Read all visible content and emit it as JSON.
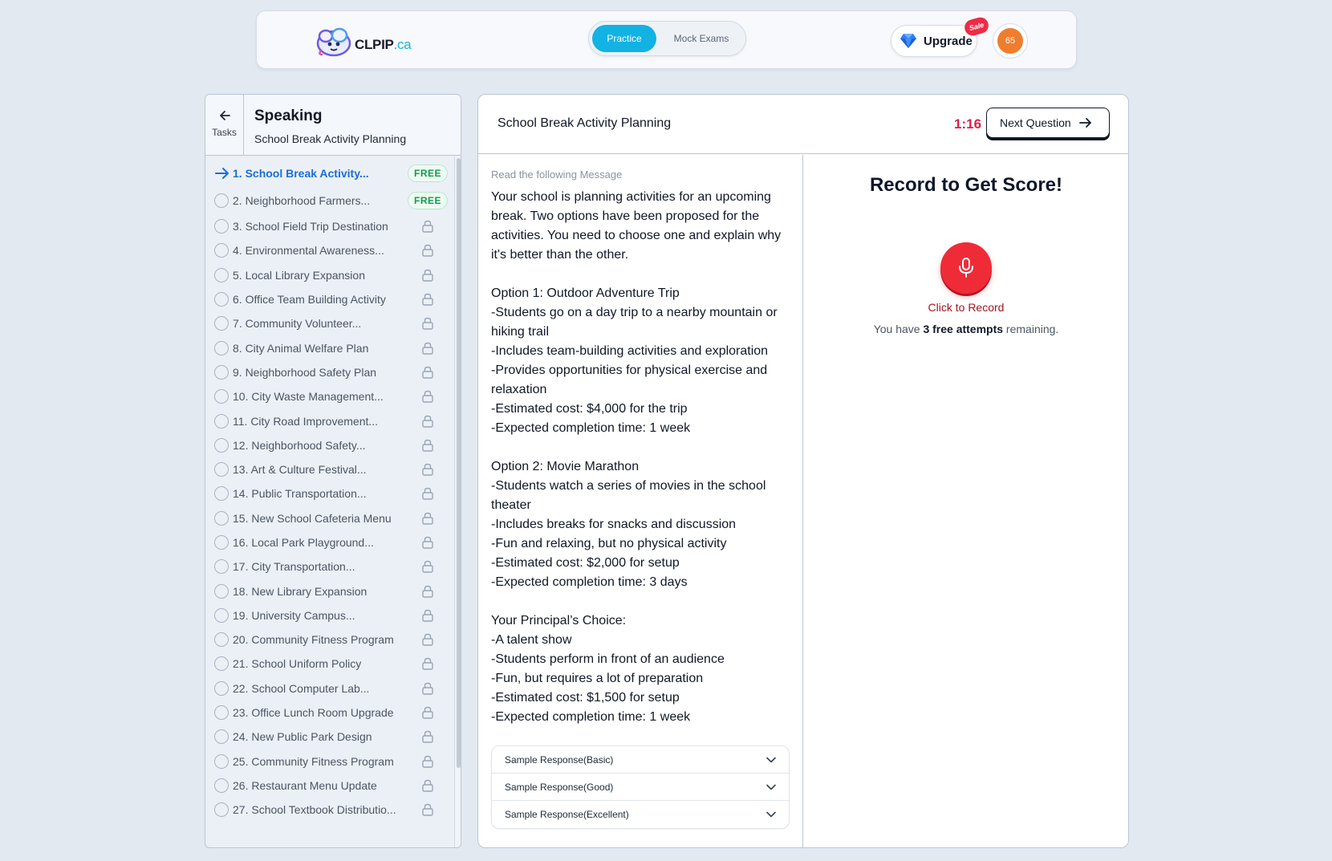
{
  "topbar": {
    "logo_text_main": "CLPIP",
    "logo_text_suffix": ".ca",
    "mode_tabs": [
      "Practice",
      "Mock Exams"
    ],
    "active_tab": "Practice",
    "upgrade_label": "Upgrade",
    "sale_badge": "Sale",
    "avatar_text": "65",
    "colors": {
      "accent": "#12b2e3",
      "sale": "#ef2b46",
      "avatar": "#f07d2e"
    }
  },
  "sidebar": {
    "back_label": "Tasks",
    "title": "Speaking",
    "subtitle": "School Break Activity Planning",
    "free_label": "FREE",
    "items": [
      {
        "label": "1. School Break Activity...",
        "status": "current",
        "badge": "free"
      },
      {
        "label": "2. Neighborhood Farmers...",
        "status": "open",
        "badge": "free"
      },
      {
        "label": "3. School Field Trip Destination",
        "status": "locked"
      },
      {
        "label": "4. Environmental Awareness...",
        "status": "locked"
      },
      {
        "label": "5. Local Library Expansion",
        "status": "locked"
      },
      {
        "label": "6. Office Team Building Activity",
        "status": "locked"
      },
      {
        "label": "7. Community Volunteer...",
        "status": "locked"
      },
      {
        "label": "8. City Animal Welfare Plan",
        "status": "locked"
      },
      {
        "label": "9. Neighborhood Safety Plan",
        "status": "locked"
      },
      {
        "label": "10. City Waste Management...",
        "status": "locked"
      },
      {
        "label": "11. City Road Improvement...",
        "status": "locked"
      },
      {
        "label": "12. Neighborhood Safety...",
        "status": "locked"
      },
      {
        "label": "13. Art & Culture Festival...",
        "status": "locked"
      },
      {
        "label": "14. Public Transportation...",
        "status": "locked"
      },
      {
        "label": "15. New School Cafeteria Menu",
        "status": "locked"
      },
      {
        "label": "16. Local Park Playground...",
        "status": "locked"
      },
      {
        "label": "17. City Transportation...",
        "status": "locked"
      },
      {
        "label": "18. New Library Expansion",
        "status": "locked"
      },
      {
        "label": "19. University Campus...",
        "status": "locked"
      },
      {
        "label": "20. Community Fitness Program",
        "status": "locked"
      },
      {
        "label": "21. School Uniform Policy",
        "status": "locked"
      },
      {
        "label": "22. School Computer Lab...",
        "status": "locked"
      },
      {
        "label": "23. Office Lunch Room Upgrade",
        "status": "locked"
      },
      {
        "label": "24. New Public Park Design",
        "status": "locked"
      },
      {
        "label": "25. Community Fitness Program",
        "status": "locked"
      },
      {
        "label": "26. Restaurant Menu Update",
        "status": "locked"
      },
      {
        "label": "27. School Textbook Distributio...",
        "status": "locked"
      }
    ]
  },
  "main": {
    "title": "School Break Activity Planning",
    "timer": "1:16",
    "next_label": "Next Question",
    "instruction": "Read the following Message",
    "message": [
      "Your school is planning activities for an upcoming break. Two options have been proposed for the activities. You need to choose one and explain why it's better than the other.",
      "",
      "Option 1: Outdoor Adventure Trip",
      "-Students go on a day trip to a nearby mountain or hiking trail",
      "-Includes team-building activities and exploration",
      "-Provides opportunities for physical exercise and relaxation",
      "-Estimated cost: $4,000 for the trip",
      "-Expected completion time: 1 week",
      "",
      "Option 2: Movie Marathon",
      "-Students watch a series of movies in the school theater",
      "-Includes breaks for snacks and discussion",
      "-Fun and relaxing, but no physical activity",
      "-Estimated cost: $2,000 for setup",
      "-Expected completion time: 3 days",
      "",
      "Your Principal’s Choice:",
      "-A talent show",
      "-Students perform in front of an audience",
      "-Fun, but requires a lot of preparation",
      "-Estimated cost: $1,500 for setup",
      "-Expected completion time: 1 week"
    ],
    "samples": [
      "Sample Response(Basic)",
      "Sample Response(Good)",
      "Sample Response(Excellent)"
    ]
  },
  "record": {
    "heading": "Record to Get Score!",
    "click_label": "Click to Record",
    "attempts_prefix": "You have ",
    "attempts_bold": "3 free attempts",
    "attempts_suffix": " remaining.",
    "colors": {
      "mic": "#ef2b38",
      "timer": "#e11d48"
    }
  }
}
